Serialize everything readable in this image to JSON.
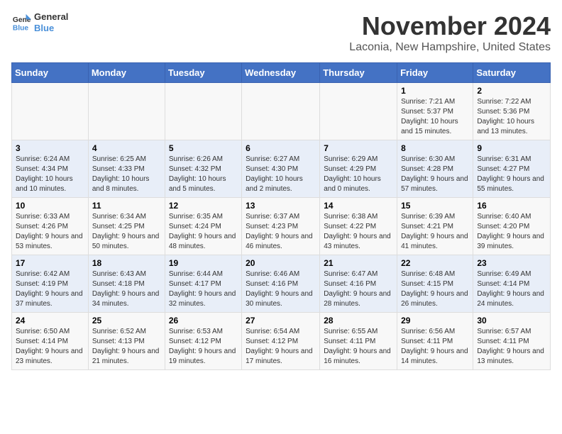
{
  "logo": {
    "line1": "General",
    "line2": "Blue"
  },
  "title": "November 2024",
  "location": "Laconia, New Hampshire, United States",
  "weekdays": [
    "Sunday",
    "Monday",
    "Tuesday",
    "Wednesday",
    "Thursday",
    "Friday",
    "Saturday"
  ],
  "weeks": [
    [
      {
        "day": "",
        "info": ""
      },
      {
        "day": "",
        "info": ""
      },
      {
        "day": "",
        "info": ""
      },
      {
        "day": "",
        "info": ""
      },
      {
        "day": "",
        "info": ""
      },
      {
        "day": "1",
        "info": "Sunrise: 7:21 AM\nSunset: 5:37 PM\nDaylight: 10 hours and 15 minutes."
      },
      {
        "day": "2",
        "info": "Sunrise: 7:22 AM\nSunset: 5:36 PM\nDaylight: 10 hours and 13 minutes."
      }
    ],
    [
      {
        "day": "3",
        "info": "Sunrise: 6:24 AM\nSunset: 4:34 PM\nDaylight: 10 hours and 10 minutes."
      },
      {
        "day": "4",
        "info": "Sunrise: 6:25 AM\nSunset: 4:33 PM\nDaylight: 10 hours and 8 minutes."
      },
      {
        "day": "5",
        "info": "Sunrise: 6:26 AM\nSunset: 4:32 PM\nDaylight: 10 hours and 5 minutes."
      },
      {
        "day": "6",
        "info": "Sunrise: 6:27 AM\nSunset: 4:30 PM\nDaylight: 10 hours and 2 minutes."
      },
      {
        "day": "7",
        "info": "Sunrise: 6:29 AM\nSunset: 4:29 PM\nDaylight: 10 hours and 0 minutes."
      },
      {
        "day": "8",
        "info": "Sunrise: 6:30 AM\nSunset: 4:28 PM\nDaylight: 9 hours and 57 minutes."
      },
      {
        "day": "9",
        "info": "Sunrise: 6:31 AM\nSunset: 4:27 PM\nDaylight: 9 hours and 55 minutes."
      }
    ],
    [
      {
        "day": "10",
        "info": "Sunrise: 6:33 AM\nSunset: 4:26 PM\nDaylight: 9 hours and 53 minutes."
      },
      {
        "day": "11",
        "info": "Sunrise: 6:34 AM\nSunset: 4:25 PM\nDaylight: 9 hours and 50 minutes."
      },
      {
        "day": "12",
        "info": "Sunrise: 6:35 AM\nSunset: 4:24 PM\nDaylight: 9 hours and 48 minutes."
      },
      {
        "day": "13",
        "info": "Sunrise: 6:37 AM\nSunset: 4:23 PM\nDaylight: 9 hours and 46 minutes."
      },
      {
        "day": "14",
        "info": "Sunrise: 6:38 AM\nSunset: 4:22 PM\nDaylight: 9 hours and 43 minutes."
      },
      {
        "day": "15",
        "info": "Sunrise: 6:39 AM\nSunset: 4:21 PM\nDaylight: 9 hours and 41 minutes."
      },
      {
        "day": "16",
        "info": "Sunrise: 6:40 AM\nSunset: 4:20 PM\nDaylight: 9 hours and 39 minutes."
      }
    ],
    [
      {
        "day": "17",
        "info": "Sunrise: 6:42 AM\nSunset: 4:19 PM\nDaylight: 9 hours and 37 minutes."
      },
      {
        "day": "18",
        "info": "Sunrise: 6:43 AM\nSunset: 4:18 PM\nDaylight: 9 hours and 34 minutes."
      },
      {
        "day": "19",
        "info": "Sunrise: 6:44 AM\nSunset: 4:17 PM\nDaylight: 9 hours and 32 minutes."
      },
      {
        "day": "20",
        "info": "Sunrise: 6:46 AM\nSunset: 4:16 PM\nDaylight: 9 hours and 30 minutes."
      },
      {
        "day": "21",
        "info": "Sunrise: 6:47 AM\nSunset: 4:16 PM\nDaylight: 9 hours and 28 minutes."
      },
      {
        "day": "22",
        "info": "Sunrise: 6:48 AM\nSunset: 4:15 PM\nDaylight: 9 hours and 26 minutes."
      },
      {
        "day": "23",
        "info": "Sunrise: 6:49 AM\nSunset: 4:14 PM\nDaylight: 9 hours and 24 minutes."
      }
    ],
    [
      {
        "day": "24",
        "info": "Sunrise: 6:50 AM\nSunset: 4:14 PM\nDaylight: 9 hours and 23 minutes."
      },
      {
        "day": "25",
        "info": "Sunrise: 6:52 AM\nSunset: 4:13 PM\nDaylight: 9 hours and 21 minutes."
      },
      {
        "day": "26",
        "info": "Sunrise: 6:53 AM\nSunset: 4:12 PM\nDaylight: 9 hours and 19 minutes."
      },
      {
        "day": "27",
        "info": "Sunrise: 6:54 AM\nSunset: 4:12 PM\nDaylight: 9 hours and 17 minutes."
      },
      {
        "day": "28",
        "info": "Sunrise: 6:55 AM\nSunset: 4:11 PM\nDaylight: 9 hours and 16 minutes."
      },
      {
        "day": "29",
        "info": "Sunrise: 6:56 AM\nSunset: 4:11 PM\nDaylight: 9 hours and 14 minutes."
      },
      {
        "day": "30",
        "info": "Sunrise: 6:57 AM\nSunset: 4:11 PM\nDaylight: 9 hours and 13 minutes."
      }
    ]
  ]
}
